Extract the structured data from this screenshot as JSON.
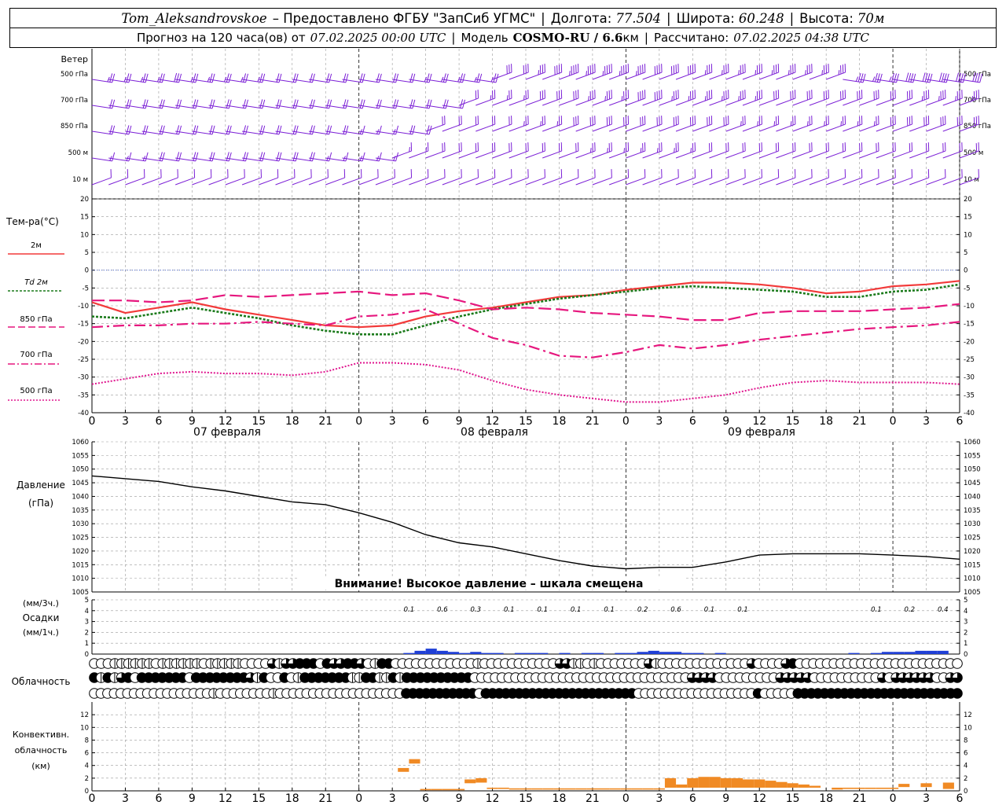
{
  "header": {
    "station": "Tom_Aleksandrovskoe",
    "provider": "– Предоставлено ФГБУ \"ЗапСиб УГМС\"",
    "lon_label": "Долгота:",
    "lon_value": "77.504",
    "lat_label": "Широта:",
    "lat_value": "60.248",
    "alt_label": "Высота:",
    "alt_value": "70м",
    "forecast_label": "Прогноз на 120 часа(ов) от",
    "forecast_start": "07.02.2025 00:00 UTC",
    "model_label": "Модель",
    "model_name": "COSMO-RU / 6.6",
    "model_unit": "км",
    "calc_label": "Рассчитано:",
    "calc_time": "07.02.2025 04:38 UTC"
  },
  "panel_labels": {
    "wind": "Ветер",
    "wind_levels": [
      "500 гПа",
      "700 гПа",
      "850 гПа",
      "500 м",
      "10 м"
    ],
    "temp_title": "Тем-ра(°C)",
    "temp_legend": [
      "2м",
      "Td 2м",
      "850 гПа",
      "700 гПа",
      "500 гПа"
    ],
    "pressure_title": [
      "Давление",
      "(гПа)"
    ],
    "pressure_warning": "Внимание! Высокое давление – шкала смещена",
    "precip_title": [
      "(мм/3ч.)",
      "Осадки",
      "(мм/1ч.)"
    ],
    "cloud_title": "Облачность",
    "conv_title": [
      "Конвективн.",
      "облачность",
      "(км)"
    ]
  },
  "colors": {
    "wind": "#7b1fd6",
    "t2m": "#f23a3a",
    "td2m": "#1a7a1a",
    "t850": "#e6177e",
    "t700": "#e6177e",
    "t500": "#e0168f",
    "pressure": "#000000",
    "precip": "#1f3fd6",
    "conv": "#f08a24"
  },
  "date_labels": [
    "07 февраля",
    "08 февраля",
    "09 февраля"
  ],
  "chart_data": [
    {
      "type": "line",
      "name": "temperature",
      "ylim": [
        -40,
        20
      ],
      "yticks": [
        20,
        15,
        10,
        5,
        0,
        -5,
        -10,
        -15,
        -20,
        -25,
        -30,
        -35,
        -40
      ],
      "x_hours": [
        0,
        3,
        6,
        9,
        12,
        15,
        18,
        21,
        24,
        27,
        30,
        33,
        36,
        39,
        42,
        45,
        48,
        51,
        54,
        57,
        60,
        63,
        66,
        69,
        72,
        75,
        78
      ],
      "xtick_labels": [
        "0",
        "3",
        "6",
        "9",
        "12",
        "15",
        "18",
        "21",
        "0",
        "3",
        "6",
        "9",
        "12",
        "15",
        "18",
        "21",
        "0",
        "3",
        "6",
        "9",
        "12",
        "15",
        "18",
        "21",
        "0",
        "3",
        "6"
      ],
      "series": [
        {
          "name": "2м",
          "key": "t2m",
          "values": [
            -9,
            -12,
            -10.5,
            -9,
            -11,
            -12.5,
            -14,
            -15.5,
            -16,
            -15.5,
            -13,
            -11.5,
            -10.5,
            -9,
            -7.5,
            -7,
            -5.5,
            -4.5,
            -3.5,
            -3.5,
            -4,
            -5,
            -6.5,
            -6,
            -4.5,
            -4,
            -3
          ]
        },
        {
          "name": "Td 2м",
          "key": "td2m",
          "values": [
            -13,
            -13.5,
            -12,
            -10.5,
            -12,
            -13.5,
            -15.5,
            -17,
            -18,
            -18,
            -15.5,
            -13,
            -11,
            -9.5,
            -8,
            -7,
            -6,
            -5,
            -4.5,
            -5,
            -5.5,
            -6,
            -7.5,
            -7.5,
            -6,
            -5.5,
            -4
          ]
        },
        {
          "name": "850 гПа",
          "key": "t850",
          "values": [
            -8.5,
            -8.5,
            -9,
            -8.5,
            -7,
            -7.5,
            -7,
            -6.5,
            -6,
            -7,
            -6.5,
            -8.5,
            -11,
            -10.5,
            -11,
            -12,
            -12.5,
            -13,
            -14,
            -14,
            -12,
            -11.5,
            -11.5,
            -11.5,
            -11,
            -10.5,
            -9.5
          ]
        },
        {
          "name": "700 гПа",
          "key": "t700",
          "values": [
            -16,
            -15.5,
            -15.5,
            -15,
            -15,
            -14.5,
            -15,
            -15.5,
            -13,
            -12.5,
            -11,
            -15,
            -19,
            -21,
            -24,
            -24.5,
            -23,
            -21,
            -22,
            -21,
            -19.5,
            -18.5,
            -17.5,
            -16.5,
            -16,
            -15.5,
            -14.5
          ]
        },
        {
          "name": "500 гПа",
          "key": "t500",
          "values": [
            -32,
            -30.5,
            -29,
            -28.5,
            -29,
            -29,
            -29.5,
            -28.5,
            -26,
            -26,
            -26.5,
            -28,
            -31,
            -33.5,
            -35,
            -36,
            -37,
            -37,
            -36,
            -35,
            -33,
            -31.5,
            -31,
            -31.5,
            -31.5,
            -31.5,
            -32
          ]
        }
      ]
    },
    {
      "type": "line",
      "name": "pressure",
      "ylim": [
        1005,
        1060
      ],
      "yticks": [
        1060,
        1055,
        1050,
        1045,
        1040,
        1035,
        1030,
        1025,
        1020,
        1015,
        1010,
        1005
      ],
      "x_hours": [
        0,
        3,
        6,
        9,
        12,
        15,
        18,
        21,
        24,
        27,
        30,
        33,
        36,
        39,
        42,
        45,
        48,
        51,
        54,
        57,
        60,
        63,
        66,
        69,
        72,
        75,
        78
      ],
      "series": [
        {
          "name": "Давление",
          "values": [
            1047.5,
            1046.5,
            1045.5,
            1043.5,
            1042,
            1040,
            1038,
            1037,
            1034,
            1030.5,
            1026,
            1023,
            1021.5,
            1019,
            1016.5,
            1014.5,
            1013.5,
            1014,
            1014,
            1016,
            1018.5,
            1019,
            1019,
            1019,
            1018.5,
            1018,
            1017
          ]
        }
      ]
    },
    {
      "type": "bar",
      "name": "precipitation",
      "ylim": [
        0,
        5
      ],
      "yticks": [
        5,
        4,
        3,
        2,
        1,
        0
      ],
      "labels_3h": [
        {
          "x_hour": 28.5,
          "text": "0.1"
        },
        {
          "x_hour": 31.5,
          "text": "0.6"
        },
        {
          "x_hour": 34.5,
          "text": "0.3"
        },
        {
          "x_hour": 37.5,
          "text": "0.1"
        },
        {
          "x_hour": 40.5,
          "text": "0.1"
        },
        {
          "x_hour": 43.5,
          "text": "0.1"
        },
        {
          "x_hour": 46.5,
          "text": "0.1"
        },
        {
          "x_hour": 49.5,
          "text": "0.2"
        },
        {
          "x_hour": 52.5,
          "text": "0.6"
        },
        {
          "x_hour": 55.5,
          "text": "0.1"
        },
        {
          "x_hour": 58.5,
          "text": "0.1"
        },
        {
          "x_hour": 70.5,
          "text": "0.1"
        },
        {
          "x_hour": 73.5,
          "text": "0.2"
        },
        {
          "x_hour": 76.5,
          "text": "0.4"
        }
      ],
      "hourly": [
        {
          "x_hour": 29,
          "value": 0.1
        },
        {
          "x_hour": 30,
          "value": 0.3
        },
        {
          "x_hour": 31,
          "value": 0.5
        },
        {
          "x_hour": 32,
          "value": 0.3
        },
        {
          "x_hour": 33,
          "value": 0.2
        },
        {
          "x_hour": 34,
          "value": 0.1
        },
        {
          "x_hour": 35,
          "value": 0.2
        },
        {
          "x_hour": 36,
          "value": 0.1
        },
        {
          "x_hour": 37,
          "value": 0.1
        },
        {
          "x_hour": 39,
          "value": 0.1
        },
        {
          "x_hour": 40,
          "value": 0.1
        },
        {
          "x_hour": 41,
          "value": 0.1
        },
        {
          "x_hour": 43,
          "value": 0.1
        },
        {
          "x_hour": 45,
          "value": 0.1
        },
        {
          "x_hour": 46,
          "value": 0.1
        },
        {
          "x_hour": 48,
          "value": 0.1
        },
        {
          "x_hour": 49,
          "value": 0.1
        },
        {
          "x_hour": 50,
          "value": 0.2
        },
        {
          "x_hour": 51,
          "value": 0.3
        },
        {
          "x_hour": 52,
          "value": 0.2
        },
        {
          "x_hour": 53,
          "value": 0.2
        },
        {
          "x_hour": 54,
          "value": 0.1
        },
        {
          "x_hour": 55,
          "value": 0.1
        },
        {
          "x_hour": 57,
          "value": 0.1
        },
        {
          "x_hour": 69,
          "value": 0.1
        },
        {
          "x_hour": 71,
          "value": 0.1
        },
        {
          "x_hour": 72,
          "value": 0.2
        },
        {
          "x_hour": 73,
          "value": 0.2
        },
        {
          "x_hour": 74,
          "value": 0.2
        },
        {
          "x_hour": 75,
          "value": 0.3
        },
        {
          "x_hour": 76,
          "value": 0.3
        },
        {
          "x_hour": 77,
          "value": 0.3
        }
      ]
    },
    {
      "type": "bar",
      "name": "convective_cloud",
      "ylim": [
        0,
        14
      ],
      "yticks": [
        12,
        10,
        8,
        6,
        4,
        2,
        0
      ],
      "bars": [
        {
          "x_hour": 28.5,
          "base": 3,
          "top": 3.6
        },
        {
          "x_hour": 29.5,
          "base": 4.3,
          "top": 5
        },
        {
          "x_hour": 30.5,
          "base": 0.1,
          "top": 0.3
        },
        {
          "x_hour": 31.5,
          "base": 0.1,
          "top": 0.3
        },
        {
          "x_hour": 32.5,
          "base": 0.1,
          "top": 0.3
        },
        {
          "x_hour": 33.5,
          "base": 0.1,
          "top": 0.3
        },
        {
          "x_hour": 34.5,
          "base": 1.2,
          "top": 1.8
        },
        {
          "x_hour": 35.5,
          "base": 1.3,
          "top": 2
        },
        {
          "x_hour": 36.5,
          "base": 0.3,
          "top": 0.5
        },
        {
          "x_hour": 37.5,
          "base": 0.3,
          "top": 0.5
        },
        {
          "x_hour": 38.5,
          "base": 0.2,
          "top": 0.4
        },
        {
          "x_hour": 39.5,
          "base": 0.2,
          "top": 0.4
        },
        {
          "x_hour": 40.5,
          "base": 0.2,
          "top": 0.4
        },
        {
          "x_hour": 41.5,
          "base": 0.2,
          "top": 0.4
        },
        {
          "x_hour": 42.5,
          "base": 0.2,
          "top": 0.4
        },
        {
          "x_hour": 43.5,
          "base": 0.2,
          "top": 0.4
        },
        {
          "x_hour": 44.5,
          "base": 0.2,
          "top": 0.4
        },
        {
          "x_hour": 45.5,
          "base": 0.2,
          "top": 0.4
        },
        {
          "x_hour": 46.5,
          "base": 0.2,
          "top": 0.4
        },
        {
          "x_hour": 47.5,
          "base": 0.2,
          "top": 0.4
        },
        {
          "x_hour": 48.5,
          "base": 0.2,
          "top": 0.4
        },
        {
          "x_hour": 49.5,
          "base": 0.2,
          "top": 0.4
        },
        {
          "x_hour": 50.5,
          "base": 0.2,
          "top": 0.4
        },
        {
          "x_hour": 51.5,
          "base": 0.2,
          "top": 0.4
        },
        {
          "x_hour": 52.5,
          "base": 0.5,
          "top": 2
        },
        {
          "x_hour": 53.5,
          "base": 0.5,
          "top": 1
        },
        {
          "x_hour": 54.5,
          "base": 0.5,
          "top": 2
        },
        {
          "x_hour": 55.5,
          "base": 0.5,
          "top": 2.2
        },
        {
          "x_hour": 56.5,
          "base": 0.5,
          "top": 2.2
        },
        {
          "x_hour": 57.5,
          "base": 0.5,
          "top": 2
        },
        {
          "x_hour": 58.5,
          "base": 0.5,
          "top": 2
        },
        {
          "x_hour": 59.5,
          "base": 0.5,
          "top": 1.8
        },
        {
          "x_hour": 60.5,
          "base": 0.5,
          "top": 1.8
        },
        {
          "x_hour": 61.5,
          "base": 0.5,
          "top": 1.6
        },
        {
          "x_hour": 62.5,
          "base": 0.5,
          "top": 1.4
        },
        {
          "x_hour": 63.5,
          "base": 0.5,
          "top": 1.2
        },
        {
          "x_hour": 64.5,
          "base": 0.5,
          "top": 1
        },
        {
          "x_hour": 65.5,
          "base": 0.5,
          "top": 0.8
        },
        {
          "x_hour": 67.5,
          "base": 0.2,
          "top": 0.5
        },
        {
          "x_hour": 68.5,
          "base": 0.3,
          "top": 0.5
        },
        {
          "x_hour": 69.5,
          "base": 0.3,
          "top": 0.5
        },
        {
          "x_hour": 70.5,
          "base": 0.3,
          "top": 0.5
        },
        {
          "x_hour": 71.5,
          "base": 0.3,
          "top": 0.5
        },
        {
          "x_hour": 72.5,
          "base": 0.3,
          "top": 0.5
        },
        {
          "x_hour": 73.5,
          "base": 0.6,
          "top": 1.1
        },
        {
          "x_hour": 75.5,
          "base": 0.6,
          "top": 1.2
        },
        {
          "x_hour": 77.5,
          "base": 0.3,
          "top": 1.3
        }
      ]
    },
    {
      "type": "table",
      "name": "cloud_cover_rows",
      "rows": [
        "0001111110111111011111000031332220233223012200000000000010000000000033110100000003100000000000003000032000000000000000000000000",
        "21213242222222022222222312002012222222112211212222222222000000000000000000000000000000003333000000000333330000000000303333330033",
        "00000000000000000010000000010000000000000000000222222222220222222222222222222222220000000000000000002000002222222222222222222222222"
      ]
    },
    {
      "type": "table",
      "name": "wind_barbs",
      "levels": [
        "500 гПа",
        "700 гПа",
        "850 гПа",
        "500 м",
        "10 м"
      ],
      "x_hours": [
        0,
        6,
        12,
        18,
        24,
        30,
        36,
        42,
        48,
        54,
        60,
        66,
        72,
        78
      ],
      "speed_ms": [
        [
          12,
          14,
          12,
          10,
          10,
          12,
          14,
          22,
          22,
          18,
          17,
          17,
          19,
          20
        ],
        [
          10,
          11,
          11,
          10,
          9,
          10,
          12,
          16,
          19,
          18,
          16,
          15,
          16,
          17
        ],
        [
          9,
          10,
          11,
          10,
          8,
          10,
          11,
          14,
          15,
          14,
          13,
          13,
          14,
          14
        ],
        [
          8,
          9,
          10,
          9,
          7,
          9,
          10,
          11,
          12,
          11,
          10,
          10,
          11,
          11
        ],
        [
          4,
          5,
          5,
          5,
          4,
          5,
          6,
          6,
          6,
          6,
          5,
          5,
          6,
          6
        ]
      ],
      "direction_deg": [
        [
          250,
          255,
          260,
          255,
          250,
          240,
          230,
          220,
          215,
          220,
          225,
          230,
          235,
          235
        ],
        [
          245,
          250,
          255,
          250,
          245,
          235,
          225,
          215,
          210,
          215,
          220,
          225,
          230,
          230
        ],
        [
          240,
          245,
          250,
          245,
          240,
          230,
          220,
          210,
          205,
          210,
          215,
          220,
          225,
          225
        ],
        [
          235,
          240,
          245,
          240,
          235,
          225,
          215,
          205,
          200,
          205,
          210,
          215,
          220,
          220
        ],
        [
          220,
          225,
          230,
          225,
          220,
          210,
          200,
          195,
          190,
          195,
          200,
          205,
          210,
          210
        ]
      ]
    }
  ]
}
